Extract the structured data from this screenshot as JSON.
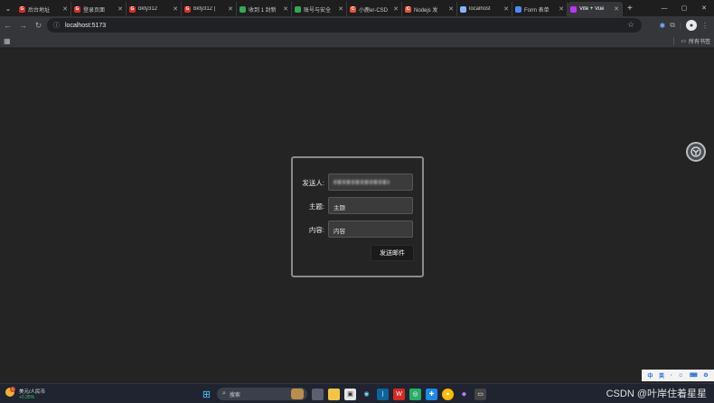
{
  "browser": {
    "tabs": [
      {
        "title": "后台地址",
        "favicon_color": "#d93025",
        "favicon_text": "G",
        "active": false
      },
      {
        "title": "登录页面",
        "favicon_color": "#d93025",
        "favicon_text": "G",
        "active": false
      },
      {
        "title": "bkty312",
        "favicon_color": "#d93025",
        "favicon_text": "G",
        "active": false
      },
      {
        "title": "bkty312 |",
        "favicon_color": "#d93025",
        "favicon_text": "G",
        "active": false
      },
      {
        "title": "收到 1 封新",
        "favicon_color": "#34a853",
        "favicon_text": "",
        "active": false
      },
      {
        "title": "账号与安全",
        "favicon_color": "#34a853",
        "favicon_text": "",
        "active": false
      },
      {
        "title": "小鹿er-CSD",
        "favicon_color": "#e8533a",
        "favicon_text": "C",
        "active": false
      },
      {
        "title": "Nodejs 发",
        "favicon_color": "#e8533a",
        "favicon_text": "C",
        "active": false
      },
      {
        "title": "localhost",
        "favicon_color": "#8ab4f8",
        "favicon_text": "",
        "active": false
      },
      {
        "title": "Form 表单",
        "favicon_color": "#4c8bf5",
        "favicon_text": "",
        "active": false
      },
      {
        "title": "Vite + Vue",
        "favicon_color": "#bd34fe",
        "favicon_text": "",
        "active": true
      }
    ],
    "new_tab_label": "+",
    "url": "localhost:5173",
    "bookmarks_folder_label": "所有书签"
  },
  "form": {
    "sender_label": "发送人:",
    "subject_label": "主题:",
    "content_label": "内容:",
    "subject_value": "主题",
    "content_value": "内容",
    "submit_label": "发送邮件"
  },
  "taskbar": {
    "weather_line1": "美元/人民币",
    "weather_line2": "+0.35%",
    "weather_badge": "1",
    "search_placeholder": "搜索",
    "watermark": "CSDN @叶岸住着星星"
  },
  "ime": {
    "items": [
      "中",
      "英",
      "·",
      "☺",
      "⌨",
      "⚙"
    ]
  },
  "colors": {
    "page_bg": "#242424",
    "form_border": "#8a8a8a",
    "input_bg": "#3b3b3b",
    "button_bg": "#1a1a1a"
  }
}
